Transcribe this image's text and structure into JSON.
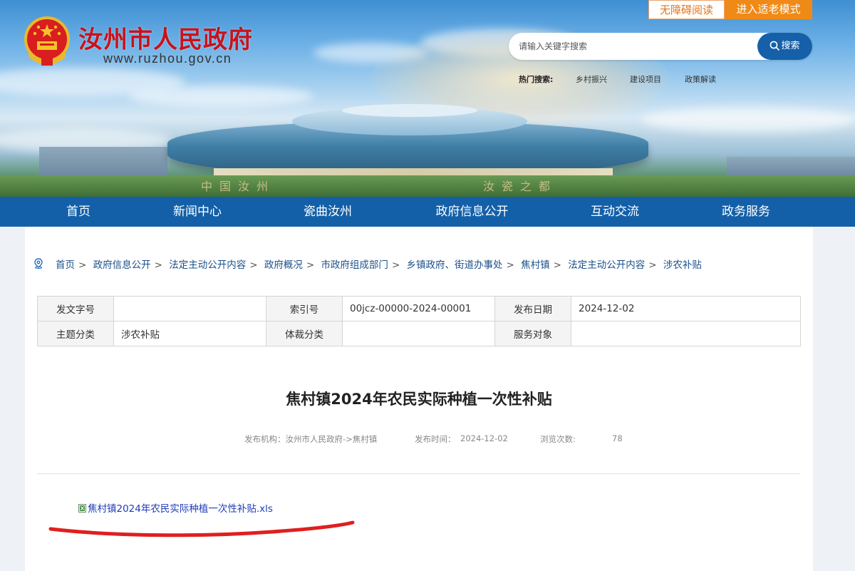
{
  "header": {
    "site_title": "汝州市人民政府",
    "site_url": "www.ruzhou.gov.cn",
    "accessibility_button": "无障碍阅读",
    "elder_mode_button": "进入适老模式",
    "search": {
      "placeholder": "请输入关键字搜索",
      "button_label": "搜索"
    },
    "hot_search": {
      "label": "热门搜索:",
      "items": [
        "乡村振兴",
        "建设项目",
        "政策解读"
      ]
    },
    "banner_slogan": [
      "中国汝州",
      "汝瓷之都"
    ]
  },
  "nav": {
    "items": [
      {
        "label": "首页"
      },
      {
        "label": "新闻中心"
      },
      {
        "label": "瓷曲汝州"
      },
      {
        "label": "政府信息公开"
      },
      {
        "label": "互动交流"
      },
      {
        "label": "政务服务"
      }
    ]
  },
  "breadcrumb": [
    "首页",
    "政府信息公开",
    "法定主动公开内容",
    "政府概况",
    "市政府组成部门",
    "乡镇政府、街道办事处",
    "焦村镇",
    "法定主动公开内容",
    "涉农补贴"
  ],
  "meta": {
    "row1": {
      "doc_no_label": "发文字号",
      "doc_no_value": "",
      "index_label": "索引号",
      "index_value": "00jcz-00000-2024-00001",
      "date_label": "发布日期",
      "date_value": "2024-12-02"
    },
    "row2": {
      "topic_label": "主题分类",
      "topic_value": "涉农补贴",
      "genre_label": "体裁分类",
      "genre_value": "",
      "audience_label": "服务对象",
      "audience_value": ""
    }
  },
  "article": {
    "title": "焦村镇2024年农民实际种植一次性补贴",
    "publisher": "发布机构：汝州市人民政府->焦村镇",
    "publish_time_label": "发布时间：",
    "publish_time": "2024-12-02",
    "views_label": "浏览次数:",
    "views": "78",
    "attachment": "焦村镇2024年农民实际种植一次性补贴.xls"
  },
  "colors": {
    "nav_bg": "#1360a9",
    "title_red": "#c8121b",
    "elder_mode_orange": "#f08a16",
    "annotation_red": "#e01f1f",
    "link_blue": "#1f3cb8"
  }
}
